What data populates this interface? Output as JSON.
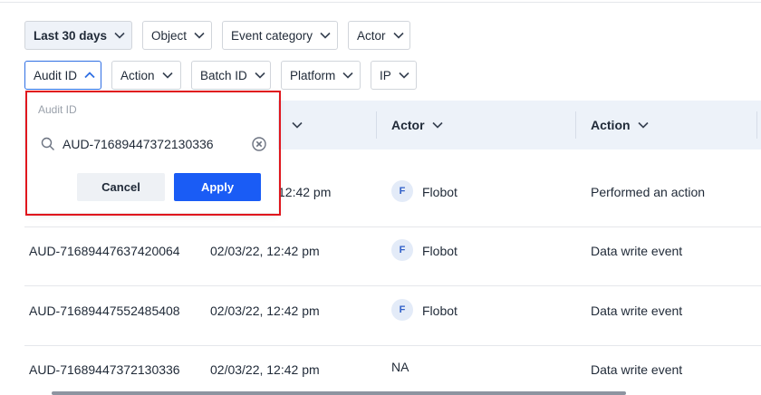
{
  "filters_row1": [
    {
      "label": "Last 30 days",
      "active": true
    },
    {
      "label": "Object"
    },
    {
      "label": "Event category"
    },
    {
      "label": "Actor"
    }
  ],
  "filters_row2": [
    {
      "label": "Audit ID",
      "open": true
    },
    {
      "label": "Action"
    },
    {
      "label": "Batch ID"
    },
    {
      "label": "Platform"
    },
    {
      "label": "IP"
    }
  ],
  "table": {
    "columns": [
      "",
      "",
      "Actor",
      "Action"
    ],
    "rows": [
      {
        "audit_id": "",
        "time": "12:42 pm",
        "actor_initial": "F",
        "actor": "Flobot",
        "action": "Performed an action"
      },
      {
        "audit_id": "AUD-71689447637420064",
        "time": "02/03/22, 12:42 pm",
        "actor_initial": "F",
        "actor": "Flobot",
        "action": "Data write event"
      },
      {
        "audit_id": "AUD-71689447552485408",
        "time": "02/03/22, 12:42 pm",
        "actor_initial": "F",
        "actor": "Flobot",
        "action": "Data write event"
      },
      {
        "audit_id": "AUD-71689447372130336",
        "time": "02/03/22, 12:42 pm",
        "actor_initial": "",
        "actor": "NA",
        "action": "Data write event"
      }
    ]
  },
  "popover": {
    "label": "Audit ID",
    "value": "AUD-71689447372130336",
    "cancel_label": "Cancel",
    "apply_label": "Apply"
  },
  "colors": {
    "accent": "#1a5cf5",
    "highlight": "#e0161d",
    "header_bg": "#edf2f9"
  },
  "icons": {
    "chevron": "chevron-down-icon",
    "chevron_up": "chevron-up-icon",
    "search": "search-icon",
    "clear": "clear-icon"
  }
}
